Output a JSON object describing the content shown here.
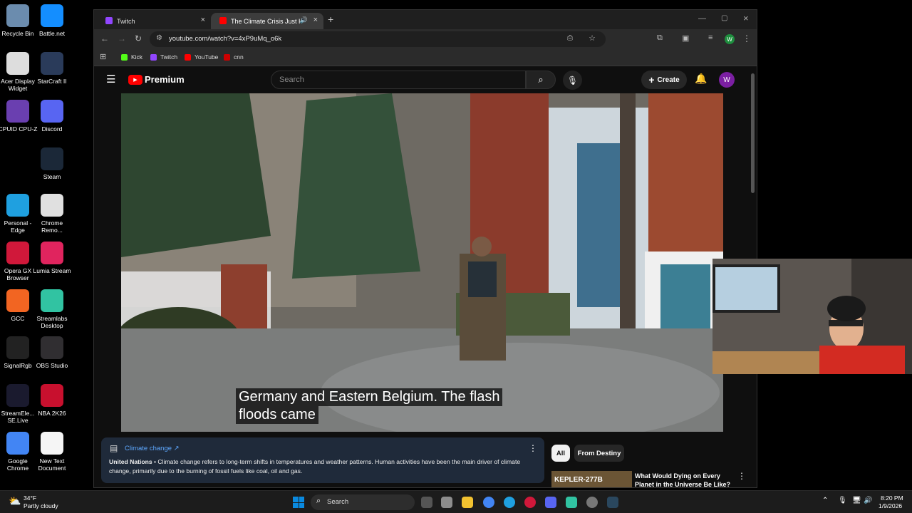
{
  "desktop": {
    "icons": [
      {
        "label": "Recycle Bin",
        "icon": "recycle-bin-icon",
        "color": "#6b8cae"
      },
      {
        "label": "Battle.net",
        "icon": "battlenet-icon",
        "color": "#148eff"
      },
      {
        "label": "Acer Display Widget",
        "icon": "acer-display-widget-icon",
        "color": "#dddddd"
      },
      {
        "label": "StarCraft II",
        "icon": "starcraft-icon",
        "color": "#2a3b5a"
      },
      {
        "label": "CPUID CPU-Z",
        "icon": "cpuz-icon",
        "color": "#6a3fb0"
      },
      {
        "label": "Discord",
        "icon": "discord-icon",
        "color": "#5865f2"
      },
      {
        "label": "Steam",
        "icon": "steam-icon",
        "color": "#1b2838"
      },
      {
        "label": "Personal - Edge",
        "icon": "edge-icon",
        "color": "#1fa0e0"
      },
      {
        "label": "Chrome Remo...",
        "icon": "chrome-remote-icon",
        "color": "#e0e0e0"
      },
      {
        "label": "Opera GX Browser",
        "icon": "opera-gx-icon",
        "color": "#d0183a"
      },
      {
        "label": "Lumia Stream",
        "icon": "lumia-stream-icon",
        "color": "#e0245e"
      },
      {
        "label": "GCC",
        "icon": "gcc-icon",
        "color": "#f26522"
      },
      {
        "label": "Streamlabs Desktop",
        "icon": "streamlabs-icon",
        "color": "#31c3a2"
      },
      {
        "label": "SignalRgb",
        "icon": "signalrgb-icon",
        "color": "#222222"
      },
      {
        "label": "OBS Studio",
        "icon": "obs-icon",
        "color": "#302e31"
      },
      {
        "label": "StreamEle... SE.Live",
        "icon": "streamelements-icon",
        "color": "#1a1a2e"
      },
      {
        "label": "NBA 2K26",
        "icon": "nba2k-icon",
        "color": "#c8102e"
      },
      {
        "label": "Google Chrome",
        "icon": "chrome-icon",
        "color": "#4285f4"
      },
      {
        "label": "New Text Document",
        "icon": "text-document-icon",
        "color": "#f5f5f5"
      }
    ]
  },
  "browser": {
    "tabs": [
      {
        "title": "Twitch",
        "icon": "twitch-favicon",
        "color": "#9146ff"
      },
      {
        "title": "The Climate Crisis Just Hit a",
        "icon": "youtube-favicon",
        "color": "#ff0000"
      }
    ],
    "new_tab": "+",
    "url": "youtube.com/watch?v=4xP9uMq_o6k",
    "bookmarks": [
      {
        "label": "Kick",
        "color": "#53fc18"
      },
      {
        "label": "Twitch",
        "color": "#9146ff"
      },
      {
        "label": "YouTube",
        "color": "#ff0000"
      },
      {
        "label": "cnn",
        "color": "#cc0000"
      }
    ],
    "profile_initial": "W"
  },
  "youtube": {
    "logo_text": "Premium",
    "search_placeholder": "Search",
    "create_label": "Create",
    "avatar_initial": "W",
    "captions": [
      "Germany and Eastern Belgium. The flash",
      "floods came"
    ],
    "info": {
      "title": "Climate change ↗",
      "source": "United Nations",
      "text": " • Climate change refers to long-term shifts in temperatures and weather patterns. Human activities have been the main driver of climate change, primarily due to the burning of fossil fuels like coal, oil and gas."
    },
    "chips": [
      "All",
      "From Destiny"
    ],
    "up_next": {
      "thumb_text": "KEPLER-277B",
      "title": "What Would Dying on Every Planet in the Universe Be Like?"
    }
  },
  "taskbar": {
    "weather_temp": "34°F",
    "weather_desc": "Partly cloudy",
    "search_label": "Search",
    "time": "8:20 PM",
    "date": "1/9/2026"
  }
}
